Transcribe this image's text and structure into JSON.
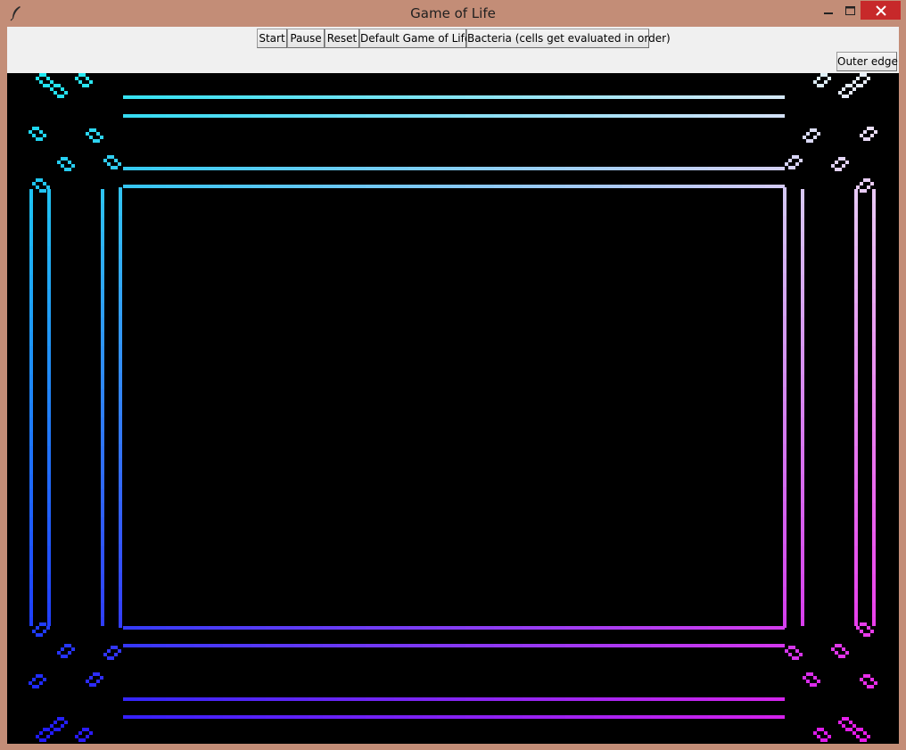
{
  "window": {
    "title": "Game of Life",
    "icon": "feather-icon",
    "border_color": "#c38d77",
    "close_color": "#c7292a"
  },
  "toolbar": {
    "buttons": {
      "start": "Start",
      "pause": "Pause",
      "reset": "Reset",
      "default_mode": "Default Game of Life",
      "bacteria_mode": "Bacteria (cells get evaluated in order)",
      "outer_edge": "Outer edge"
    }
  },
  "board": {
    "background": "#000000",
    "cell_gradient": {
      "top_left": "#18e8f0",
      "top_right": "#f0f0f8",
      "bottom_left": "#1818ff",
      "bottom_right": "#f018e8"
    }
  }
}
